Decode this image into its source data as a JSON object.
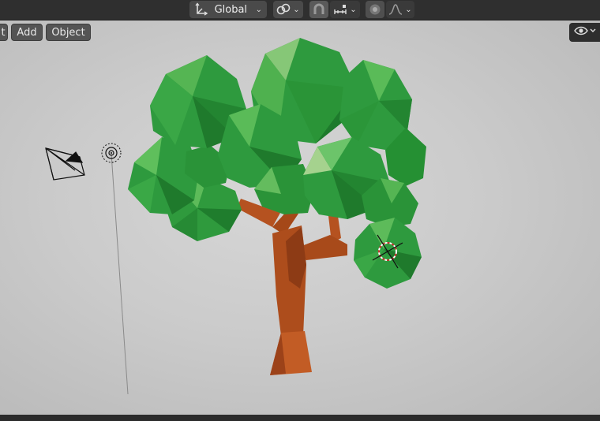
{
  "header": {
    "orientation_icon": "transform-orientation-icon",
    "orientation_label": "Global",
    "pivot_icon": "pivot-link-icon",
    "snap_icon": "snap-magnet-icon",
    "snap_target_icon": "snap-increment-icon",
    "proportional_icon": "proportional-editing-icon",
    "falloff_icon": "falloff-curve-icon"
  },
  "viewport_header": {
    "left_clip_label": "t",
    "add_label": "Add",
    "object_label": "Object",
    "visibility_icon": "eye-icon"
  },
  "scene": {
    "objects": [
      "camera",
      "light",
      "tree",
      "3d-cursor"
    ],
    "colors": {
      "foliage": "#2e9a3e",
      "foliage_light": "#6cc46a",
      "foliage_dark": "#1f7a2c",
      "trunk": "#b04e1c",
      "trunk_dark": "#8a3a14",
      "background": "#cfcfcf"
    }
  }
}
